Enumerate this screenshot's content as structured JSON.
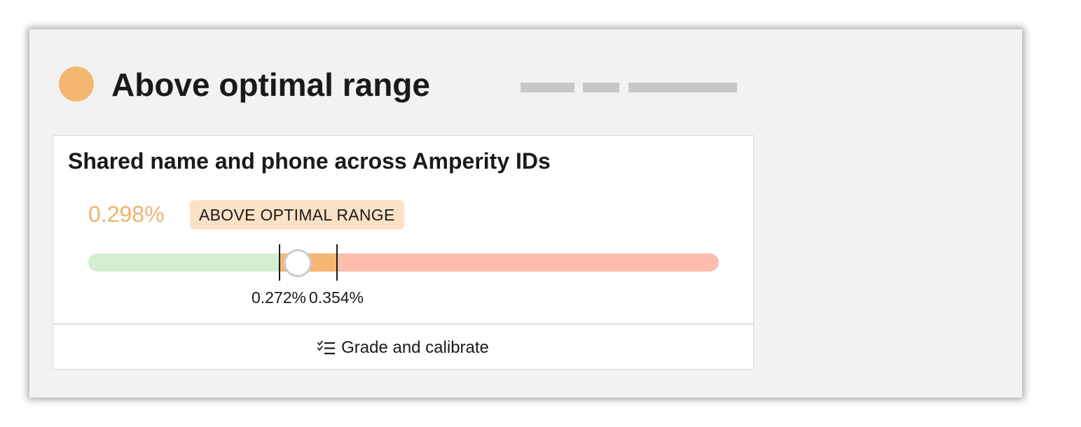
{
  "status": {
    "title": "Above optimal range",
    "dot_color": "#f5b672"
  },
  "metric_card": {
    "title": "Shared name and phone across Amperity IDs",
    "value": "0.298%",
    "value_color": "#f0b26e",
    "badge": {
      "label": "ABOVE OPTIMAL RANGE",
      "background": "#fbe1c5"
    },
    "range": {
      "min": 0.0,
      "max": 0.9,
      "current_value": 0.298,
      "segments": [
        {
          "name": "below",
          "color": "#d3efd0"
        },
        {
          "name": "above",
          "color": "#f5b672"
        },
        {
          "name": "high",
          "color": "#fdbdad"
        }
      ],
      "thresholds": [
        {
          "value": 0.272,
          "label": "0.272%"
        },
        {
          "value": 0.354,
          "label": "0.354%"
        }
      ]
    },
    "footer": {
      "label": "Grade and calibrate",
      "icon": "checklist-icon"
    }
  }
}
